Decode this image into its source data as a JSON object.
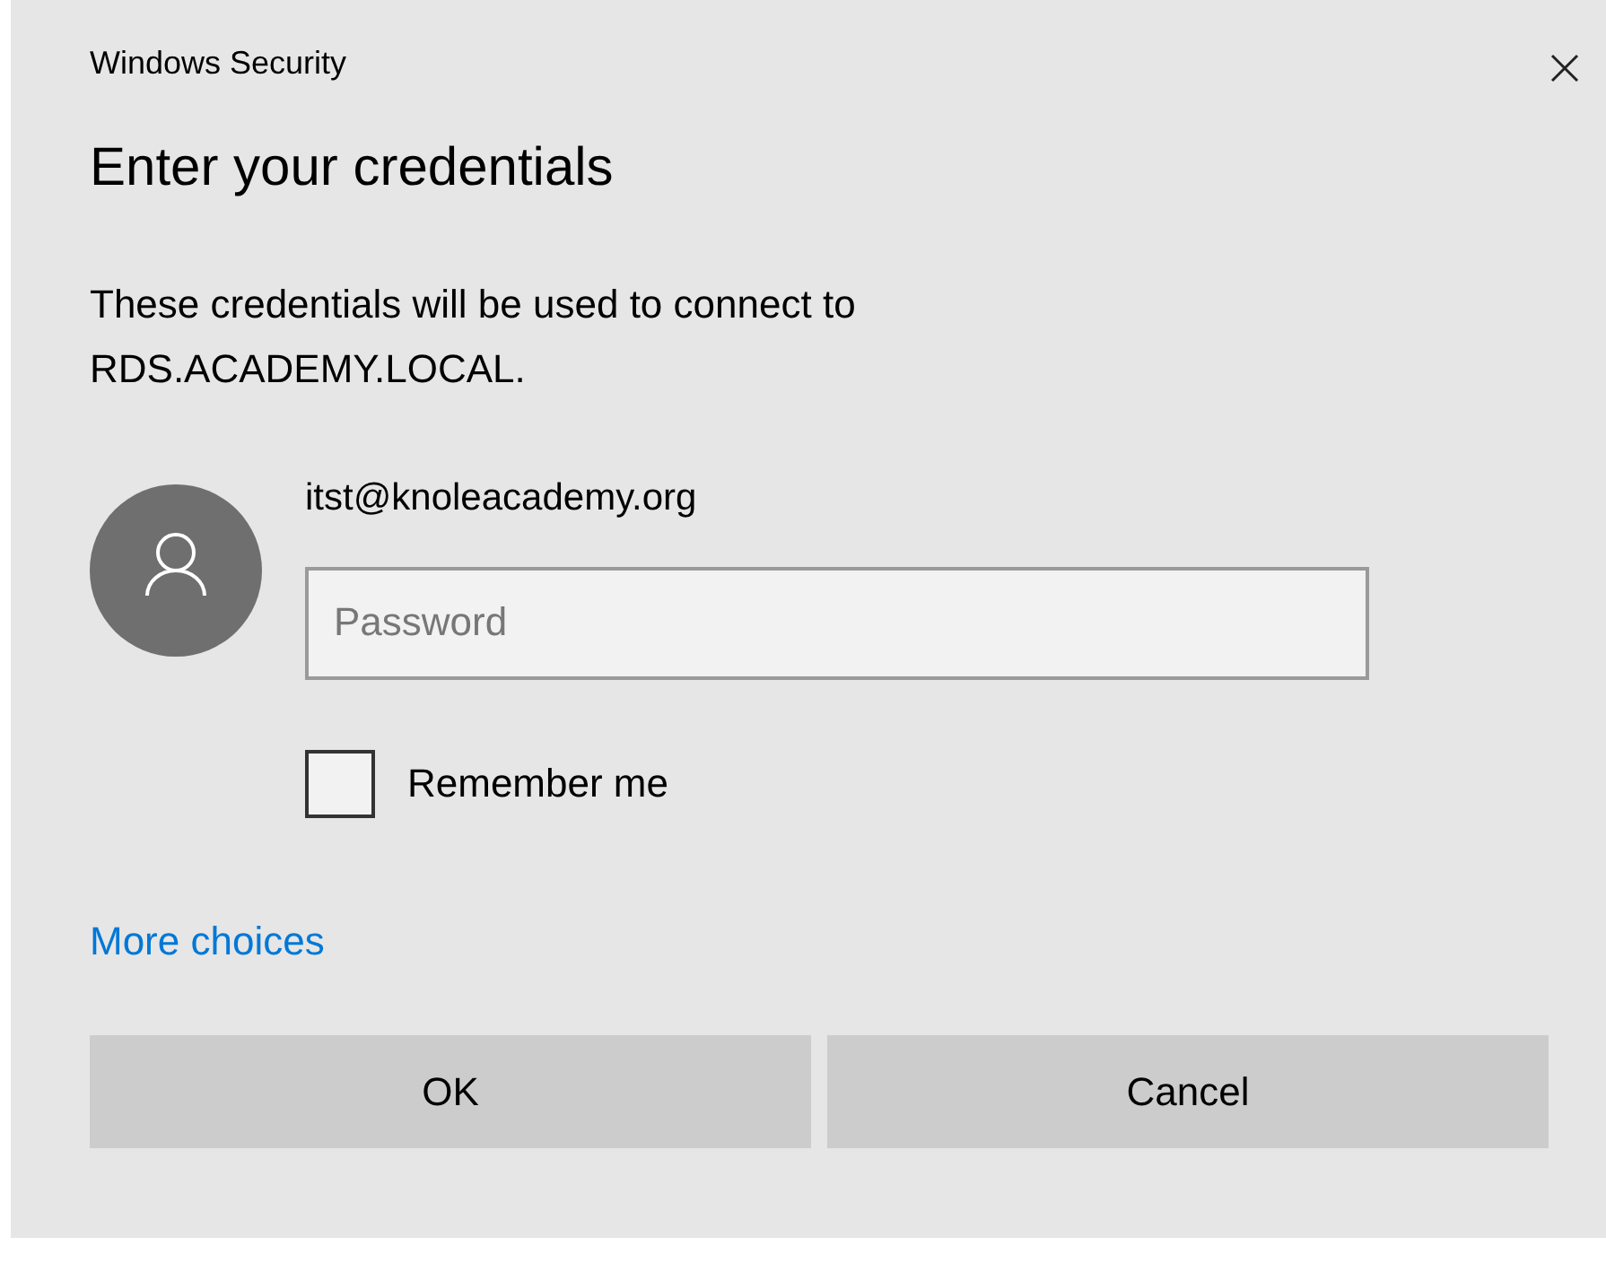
{
  "window": {
    "title": "Windows Security"
  },
  "heading": "Enter your credentials",
  "message": "These credentials will be used to connect to RDS.ACADEMY.LOCAL.",
  "account": {
    "username": "itst@knoleacademy.org"
  },
  "password": {
    "placeholder": "Password"
  },
  "remember": {
    "label": "Remember me",
    "checked": false
  },
  "more_link": "More choices",
  "buttons": [
    "OK",
    "Cancel"
  ]
}
